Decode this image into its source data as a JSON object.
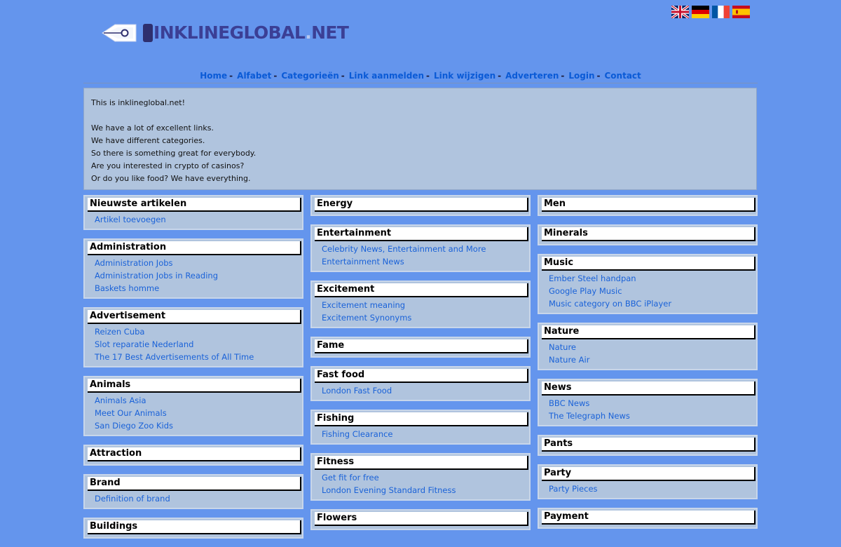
{
  "flags": [
    "uk-flag-icon",
    "german-flag-icon",
    "french-flag-icon",
    "spanish-flag-icon"
  ],
  "logo": {
    "main": "INKLINEGLOBAL",
    "dot": ".",
    "tld": "NET"
  },
  "nav": {
    "items": [
      "Home",
      "Alfabet",
      "Categorieën",
      "Link aanmelden",
      "Link wijzigen",
      "Adverteren",
      "Login",
      "Contact"
    ],
    "separator": "-"
  },
  "intro": {
    "line1": "This is inklineglobal.net!",
    "line2": "We have a lot of excellent links.",
    "line3": "We have different categories.",
    "line4": "So there is something great for everybody.",
    "line5": "Are you interested in crypto of casinos?",
    "line6": "Or do you like food? We have everything."
  },
  "col1": [
    {
      "title": "Nieuwste artikelen",
      "links": [
        "Artikel toevoegen"
      ]
    },
    {
      "title": "Administration",
      "links": [
        "Administration Jobs",
        "Administration Jobs in Reading",
        "Baskets homme"
      ]
    },
    {
      "title": "Advertisement",
      "links": [
        "Reizen Cuba",
        "Slot reparatie Nederland",
        "The 17 Best Advertisements of All Time"
      ]
    },
    {
      "title": "Animals",
      "links": [
        "Animals Asia",
        "Meet Our Animals",
        "San Diego Zoo Kids"
      ]
    },
    {
      "title": "Attraction",
      "links": []
    },
    {
      "title": "Brand",
      "links": [
        "Definition of brand"
      ]
    },
    {
      "title": "Buildings",
      "links": []
    }
  ],
  "col2": [
    {
      "title": "Energy",
      "links": []
    },
    {
      "title": "Entertainment",
      "links": [
        "Celebrity News, Entertainment and More",
        "Entertainment News"
      ]
    },
    {
      "title": "Excitement",
      "links": [
        "Excitement meaning",
        "Excitement Synonyms"
      ]
    },
    {
      "title": "Fame",
      "links": []
    },
    {
      "title": "Fast food",
      "links": [
        "London Fast Food"
      ]
    },
    {
      "title": "Fishing",
      "links": [
        "Fishing Clearance"
      ]
    },
    {
      "title": "Fitness",
      "links": [
        "Get fit for free",
        "London Evening Standard Fitness"
      ]
    },
    {
      "title": "Flowers",
      "links": []
    }
  ],
  "col3": [
    {
      "title": "Men",
      "links": []
    },
    {
      "title": "Minerals",
      "links": []
    },
    {
      "title": "Music",
      "links": [
        "Ember Steel handpan",
        "Google Play Music",
        "Music category on BBC iPlayer"
      ]
    },
    {
      "title": "Nature",
      "links": [
        "Nature",
        "Nature Air"
      ]
    },
    {
      "title": "News",
      "links": [
        "BBC News",
        "The Telegraph News"
      ]
    },
    {
      "title": "Pants",
      "links": []
    },
    {
      "title": "Party",
      "links": [
        "Party Pieces"
      ]
    },
    {
      "title": "Payment",
      "links": []
    }
  ]
}
